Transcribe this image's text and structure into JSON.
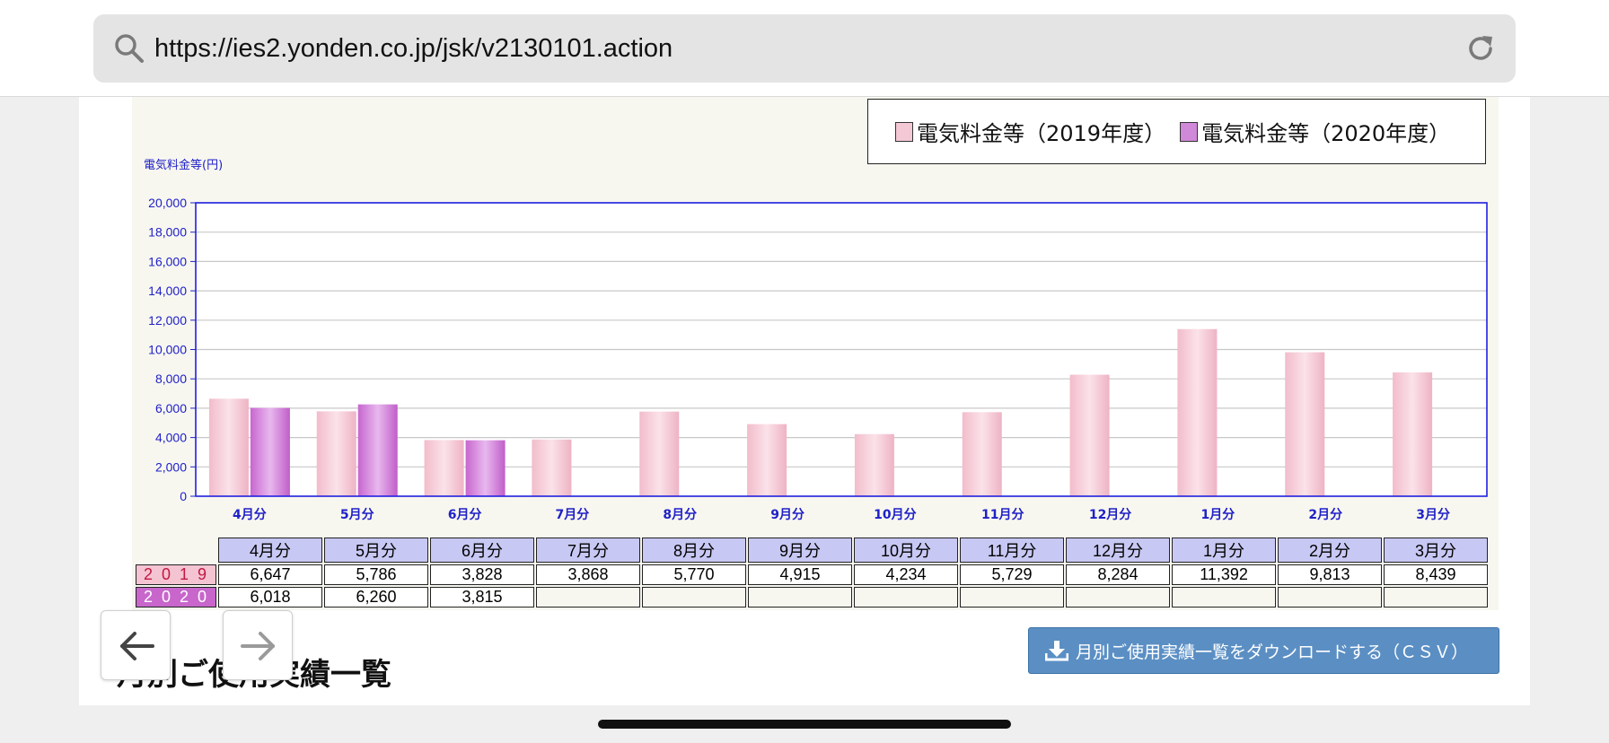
{
  "browser": {
    "url": "https://ies2.yonden.co.jp/jsk/v2130101.action",
    "search_icon": "search-icon",
    "reload_icon": "reload-icon"
  },
  "legend": {
    "items": [
      {
        "label": "電気料金等（2019年度）",
        "color": "#f4c8d4"
      },
      {
        "label": "電気料金等（2020年度）",
        "color": "#d088d8"
      }
    ]
  },
  "chart_data": {
    "type": "bar",
    "ylabel": "電気料金等(円)",
    "ylim": [
      0,
      20000
    ],
    "yticks": [
      "0",
      "2,000",
      "4,000",
      "6,000",
      "8,000",
      "10,000",
      "12,000",
      "14,000",
      "16,000",
      "18,000",
      "20,000"
    ],
    "categories": [
      "4月分",
      "5月分",
      "6月分",
      "7月分",
      "8月分",
      "9月分",
      "10月分",
      "11月分",
      "12月分",
      "1月分",
      "2月分",
      "3月分"
    ],
    "series": [
      {
        "name": "電気料金等（2019年度）",
        "values": [
          6647,
          5786,
          3828,
          3868,
          5770,
          4915,
          4234,
          5729,
          8284,
          11392,
          9813,
          8439
        ],
        "color": "#f4c8d4"
      },
      {
        "name": "電気料金等（2020年度）",
        "values": [
          6018,
          6260,
          3815,
          null,
          null,
          null,
          null,
          null,
          null,
          null,
          null,
          null
        ],
        "color": "#d088d8"
      }
    ],
    "grid": true,
    "legend_position": "top-right"
  },
  "table": {
    "headers": [
      "4月分",
      "5月分",
      "6月分",
      "7月分",
      "8月分",
      "9月分",
      "10月分",
      "11月分",
      "12月分",
      "1月分",
      "2月分",
      "3月分"
    ],
    "rows": [
      {
        "year": "2019",
        "values": [
          "6,647",
          "5,786",
          "3,828",
          "3,868",
          "5,770",
          "4,915",
          "4,234",
          "5,729",
          "8,284",
          "11,392",
          "9,813",
          "8,439"
        ]
      },
      {
        "year": "2020",
        "values": [
          "6,018",
          "6,260",
          "3,815",
          "",
          "",
          "",
          "",
          "",
          "",
          "",
          "",
          ""
        ]
      }
    ]
  },
  "nav": {
    "back_icon": "arrow-left-icon",
    "forward_icon": "arrow-right-icon"
  },
  "section": {
    "title": "月別ご使用実績一覧"
  },
  "download": {
    "label": "月別ご使用実績一覧をダウンロードする（ＣＳＶ）",
    "icon": "download-icon"
  }
}
